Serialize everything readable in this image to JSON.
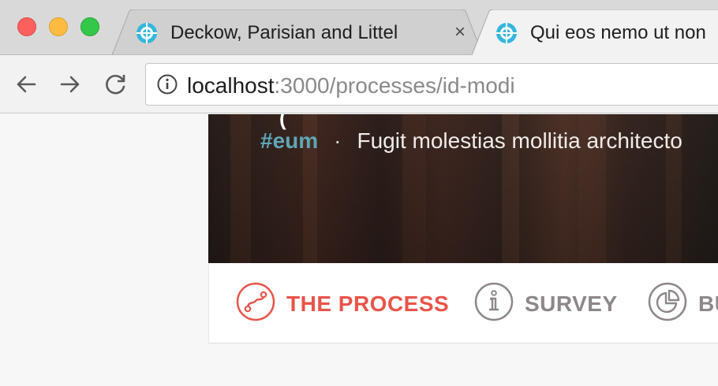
{
  "browser": {
    "tabs": [
      {
        "title": "Deckow, Parisian and Littel",
        "close": "×"
      },
      {
        "title": "Qui eos nemo ut non"
      }
    ],
    "url_host": "localhost",
    "url_rest": ":3000/processes/id-modi"
  },
  "hero": {
    "cut_text": "(",
    "tag": "#eum",
    "separator": "·",
    "description": "Fugit molestias mollitia architecto"
  },
  "nav": {
    "items": [
      {
        "label": "THE PROCESS",
        "active": true
      },
      {
        "label": "SURVEY",
        "active": false
      },
      {
        "label": "BU",
        "active": false
      }
    ]
  },
  "colors": {
    "accent": "#e8544a",
    "inactive": "#8d8789",
    "tag": "#5fa6b6",
    "favicon": "#35b6de"
  },
  "icons": [
    "reload-icon",
    "back-arrow-icon",
    "forward-arrow-icon",
    "info-icon",
    "process-icon",
    "survey-icon",
    "pie-chart-icon"
  ]
}
